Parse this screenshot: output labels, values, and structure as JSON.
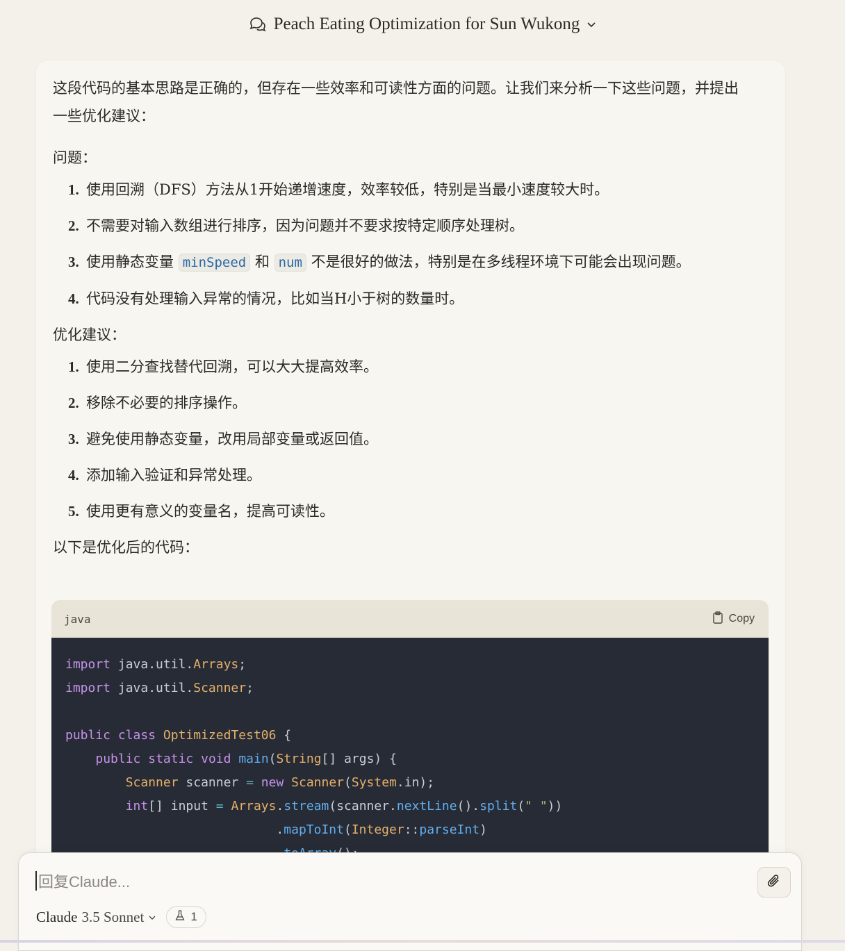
{
  "header": {
    "title": "Peach Eating Optimization for Sun Wukong"
  },
  "message": {
    "intro": "这段代码的基本思路是正确的，但存在一些效率和可读性方面的问题。让我们来分析一下这些问题，并提出一些优化建议：",
    "problems_label": "问题：",
    "problems": [
      {
        "num": "1.",
        "text": "使用回溯（DFS）方法从1开始递增速度，效率较低，特别是当最小速度较大时。"
      },
      {
        "num": "2.",
        "text": "不需要对输入数组进行排序，因为问题并不要求按特定顺序处理树。"
      },
      {
        "num": "3.",
        "pre": "使用静态变量",
        "code1": "minSpeed",
        "mid": "和",
        "code2": "num",
        "post": "不是很好的做法，特别是在多线程环境下可能会出现问题。"
      },
      {
        "num": "4.",
        "text": "代码没有处理输入异常的情况，比如当H小于树的数量时。"
      }
    ],
    "suggestions_label": "优化建议：",
    "suggestions": [
      {
        "num": "1.",
        "text": "使用二分查找替代回溯，可以大大提高效率。"
      },
      {
        "num": "2.",
        "text": "移除不必要的排序操作。"
      },
      {
        "num": "3.",
        "text": "避免使用静态变量，改用局部变量或返回值。"
      },
      {
        "num": "4.",
        "text": "添加输入验证和异常处理。"
      },
      {
        "num": "5.",
        "text": "使用更有意义的变量名，提高可读性。"
      }
    ],
    "code_intro": "以下是优化后的代码："
  },
  "code": {
    "language": "java",
    "copy_label": "Copy",
    "lines": [
      "import java.util.Arrays;",
      "import java.util.Scanner;",
      "",
      "public class OptimizedTest06 {",
      "    public static void main(String[] args) {",
      "        Scanner scanner = new Scanner(System.in);",
      "        int[] input = Arrays.stream(scanner.nextLine().split(\" \"))",
      "                            .mapToInt(Integer::parseInt)",
      "                            .toArray();"
    ]
  },
  "composer": {
    "placeholder": "回复Claude...",
    "model_name": "Claude",
    "model_version": "3.5 Sonnet",
    "badge_count": "1"
  }
}
